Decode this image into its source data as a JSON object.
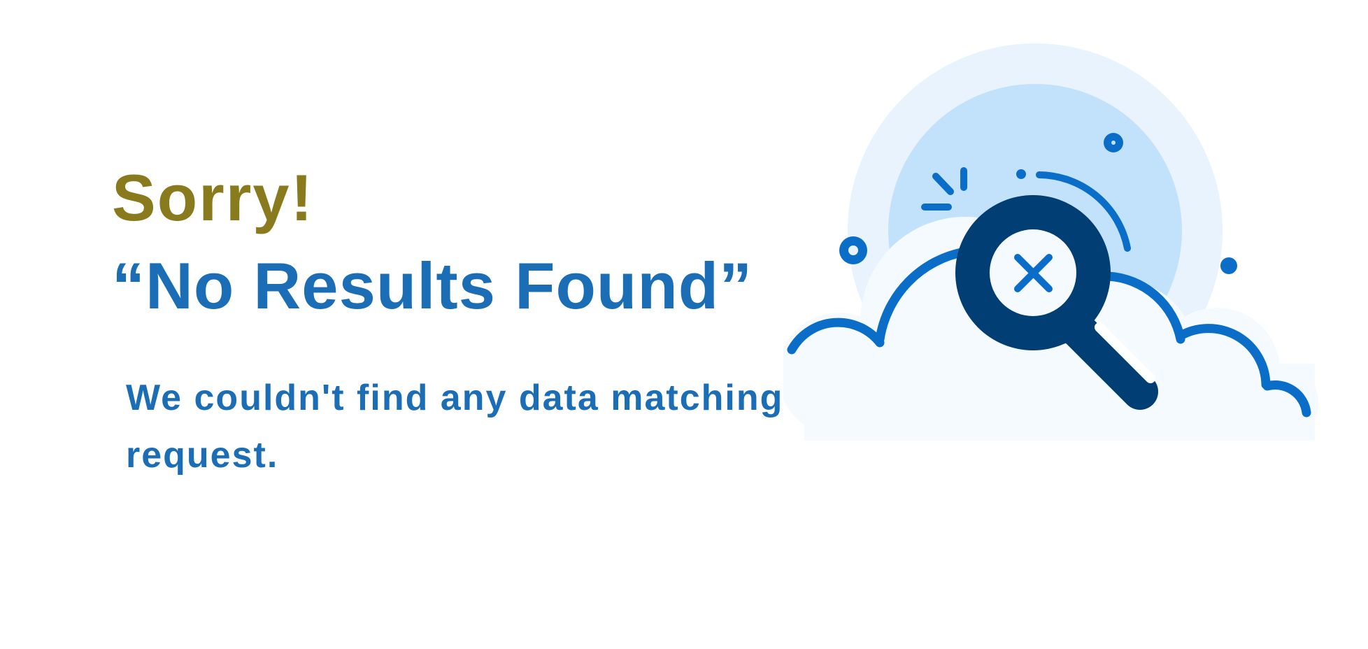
{
  "empty_state": {
    "title": "Sorry!",
    "headline": "“No Results Found”",
    "message": "We couldn't find any data matching your request."
  },
  "colors": {
    "title": "#8a7a1e",
    "text": "#1b6eb5",
    "accent": "#0a6ec9",
    "dark": "#003e73",
    "light_circle": "#e9f3fd",
    "mid_circle": "#c2e2fb",
    "cloud": "#f5fafe"
  },
  "illustration": {
    "icon": "magnifier-no-results-icon"
  }
}
